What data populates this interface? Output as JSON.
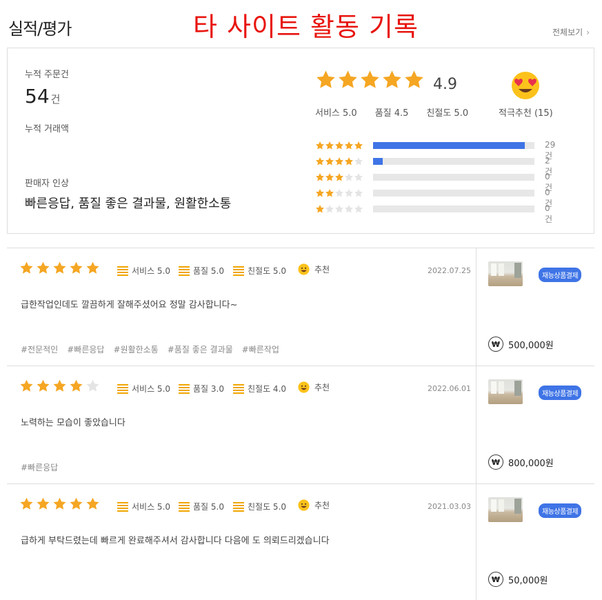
{
  "header": {
    "title": "실적/평가",
    "banner": "타 사이트 활동 기록",
    "see_all": "전체보기",
    "see_all_icon": "chevron-right-icon"
  },
  "summary": {
    "orders_label": "누적 주문건",
    "orders_value": "54",
    "orders_unit": "건",
    "amount_label": "누적 거래액",
    "impression_label": "판매자 인상",
    "impression_value": "빠른응답, 품질 좋은 결과물, 원활한소통",
    "average": "4.9",
    "stars_filled": 5,
    "service": "서비스 5.0",
    "quality": "품질 4.5",
    "kindness": "친절도 5.0",
    "recommend": "적극추천 (15)",
    "recommend_icon": "heart-eyes-emoji-icon",
    "distribution": [
      {
        "stars": 5,
        "count": "29건",
        "fraction": 0.94
      },
      {
        "stars": 4,
        "count": "2건",
        "fraction": 0.06
      },
      {
        "stars": 3,
        "count": "0건",
        "fraction": 0
      },
      {
        "stars": 2,
        "count": "0건",
        "fraction": 0
      },
      {
        "stars": 1,
        "count": "0건",
        "fraction": 0
      }
    ]
  },
  "colors": {
    "star": "#f5a623",
    "star_empty": "#e4e4e4",
    "bar": "#3f74e6",
    "banner": "#e8140e",
    "badge": "#3f74e6"
  },
  "reviews": [
    {
      "stars": 5,
      "service": "서비스 5.0",
      "quality": "품질 5.0",
      "kindness": "친절도 5.0",
      "recommend": "추천",
      "date": "2022.07.25",
      "text": "급한작업인데도 깔끔하게 잘해주셨어요 정말 감사합니다~",
      "tags": [
        "#전문적인",
        "#빠른응답",
        "#원활한소통",
        "#품질 좋은 결과물",
        "#빠른작업"
      ],
      "badge": "재능상품결제",
      "currency": "₩",
      "price": "500,000원"
    },
    {
      "stars": 4,
      "service": "서비스 5.0",
      "quality": "품질 3.0",
      "kindness": "친절도 4.0",
      "recommend": "추천",
      "date": "2022.06.01",
      "text": "노력하는 모습이 좋았습니다",
      "tags": [
        "#빠른응답"
      ],
      "badge": "재능상품결제",
      "currency": "₩",
      "price": "800,000원"
    },
    {
      "stars": 5,
      "service": "서비스 5.0",
      "quality": "품질 5.0",
      "kindness": "친절도 5.0",
      "recommend": "추천",
      "date": "2021.03.03",
      "text": "급하게 부탁드렸는데 빠르게 완료해주셔서 감사합니다 다음에 도 의뢰드리겠습니다",
      "tags": [],
      "badge": "재능상품결제",
      "currency": "₩",
      "price": "50,000원"
    }
  ]
}
